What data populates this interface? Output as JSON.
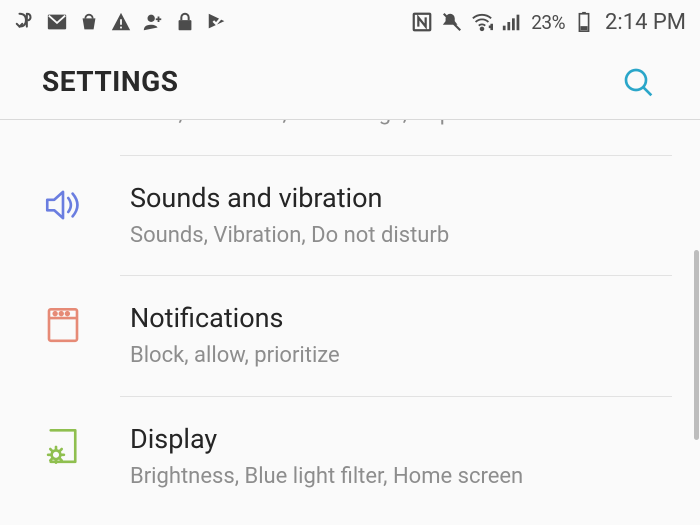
{
  "status": {
    "battery_pct": "23%",
    "clock": "2:14 PM"
  },
  "header": {
    "title": "SETTINGS"
  },
  "rows": {
    "prev_subtitle": "Wi-Fi, Bluetooth, Data usage, Airplane mode",
    "sounds": {
      "title": "Sounds and vibration",
      "subtitle": "Sounds, Vibration, Do not disturb"
    },
    "notifications": {
      "title": "Notifications",
      "subtitle": "Block, allow, prioritize"
    },
    "display": {
      "title": "Display",
      "subtitle": "Brightness, Blue light filter, Home screen"
    }
  },
  "colors": {
    "accent_search": "#2aa6c9",
    "icon_sounds": "#6a7de0",
    "icon_notifications": "#e68a76",
    "icon_display": "#8fbf4f"
  }
}
